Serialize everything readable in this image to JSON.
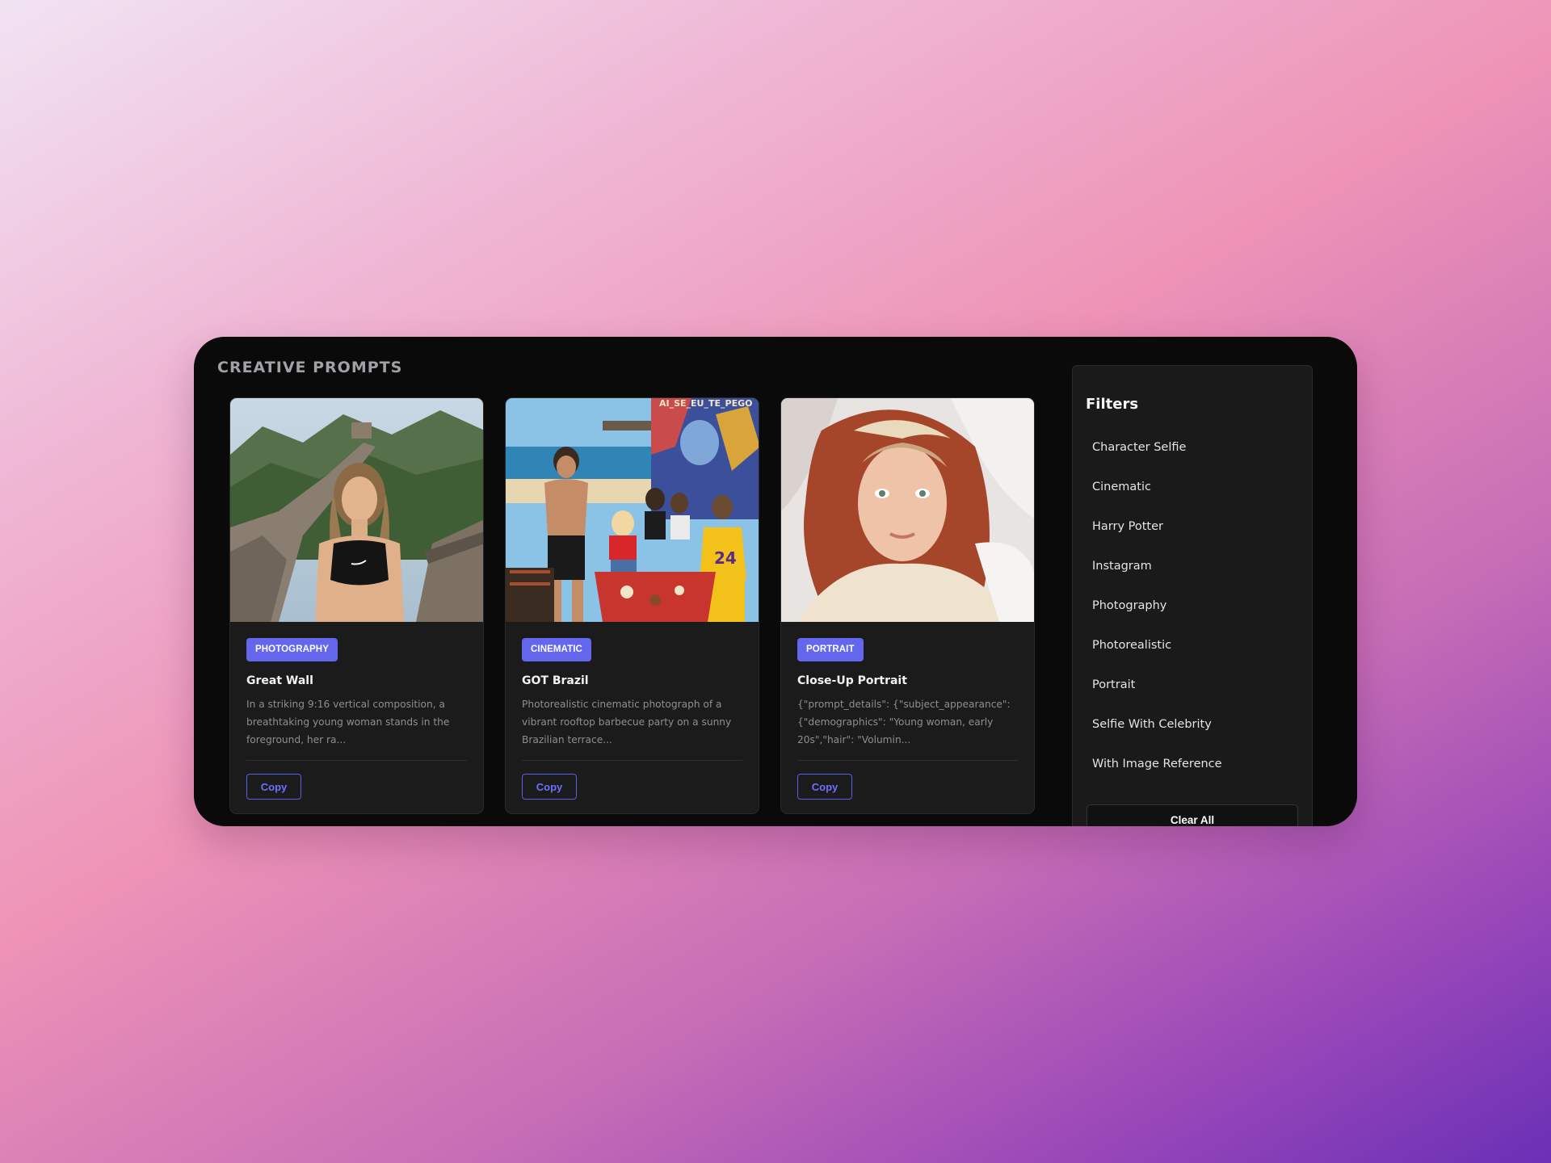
{
  "panel": {
    "title": "CREATIVE PROMPTS"
  },
  "cards": [
    {
      "category": "PHOTOGRAPHY",
      "title": "Great Wall",
      "description": "In a striking 9:16 vertical composition, a breathtaking young woman stands in the foreground, her ra...",
      "copy_label": "Copy",
      "image": "woman on the Great Wall in black sports top"
    },
    {
      "category": "CINEMATIC",
      "title": "GOT Brazil",
      "description": "Photorealistic cinematic photograph of a vibrant rooftop barbecue party on a sunny Brazilian terrace...",
      "copy_label": "Copy",
      "image": "group at a rooftop barbecue by the beach, mural sign",
      "mural_text": "AI_SE_EU_TE_PEGO",
      "jersey_number": "24"
    },
    {
      "category": "PORTRAIT",
      "title": "Close-Up Portrait",
      "description": "{\"prompt_details\": {\"subject_appearance\": {\"demographics\": \"Young woman, early 20s\",\"hair\": \"Volumin...",
      "copy_label": "Copy",
      "image": "red-haired woman selfie in bed"
    }
  ],
  "filters": {
    "title": "Filters",
    "items": [
      "Character Selfie",
      "Cinematic",
      "Harry Potter",
      "Instagram",
      "Photography",
      "Photorealistic",
      "Portrait",
      "Selfie With Celebrity",
      "With Image Reference"
    ],
    "clear_label": "Clear All"
  },
  "colors": {
    "accent": "#6466ee",
    "panel_bg": "#0a0a0a",
    "card_bg": "#1b1b1c"
  }
}
